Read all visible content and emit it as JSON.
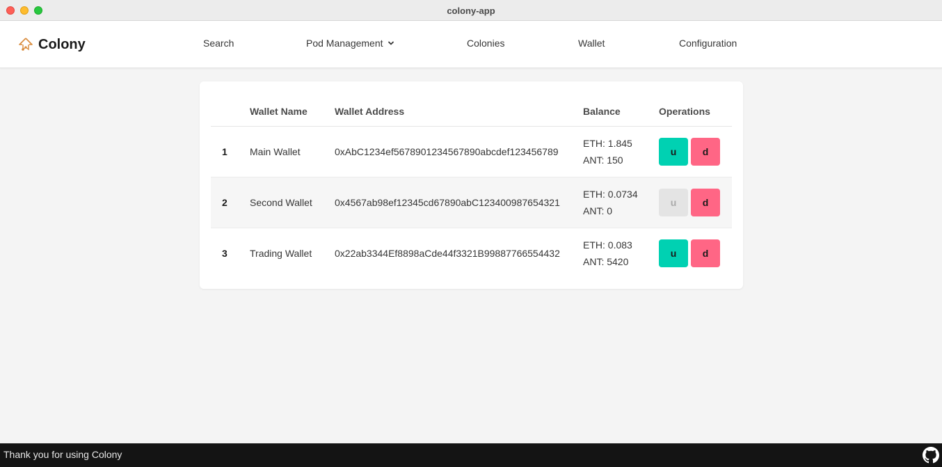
{
  "window": {
    "title": "colony-app"
  },
  "brand": {
    "name": "Colony",
    "icon": "colony-logo-icon"
  },
  "nav": {
    "search": "Search",
    "pod_management": "Pod Management",
    "colonies": "Colonies",
    "wallet": "Wallet",
    "configuration": "Configuration"
  },
  "table": {
    "headers": {
      "index": "",
      "name": "Wallet Name",
      "address": "Wallet Address",
      "balance": "Balance",
      "operations": "Operations"
    },
    "rows": [
      {
        "index": "1",
        "name": "Main Wallet",
        "address": "0xAbC1234ef5678901234567890abcdef123456789",
        "eth": "ETH: 1.845",
        "ant": "ANT: 150",
        "u_label": "u",
        "u_enabled": true,
        "d_label": "d"
      },
      {
        "index": "2",
        "name": "Second Wallet",
        "address": "0x4567ab98ef12345cd67890abC123400987654321",
        "eth": "ETH: 0.0734",
        "ant": "ANT: 0",
        "u_label": "u",
        "u_enabled": false,
        "d_label": "d"
      },
      {
        "index": "3",
        "name": "Trading Wallet",
        "address": "0x22ab3344Ef8898aCde44f3321B99887766554432",
        "eth": "ETH: 0.083",
        "ant": "ANT: 5420",
        "u_label": "u",
        "u_enabled": true,
        "d_label": "d"
      }
    ]
  },
  "footer": {
    "text": "Thank you for using Colony",
    "icon": "github-icon"
  },
  "colors": {
    "accent_teal": "#00d1b2",
    "danger_pink": "#ff6685",
    "disabled": "#e4e4e4",
    "footer_bg": "#141414"
  }
}
